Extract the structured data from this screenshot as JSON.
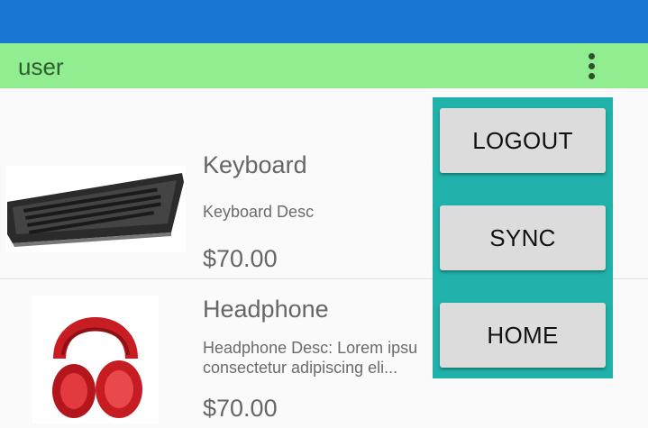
{
  "app_bar": {
    "title": "user",
    "overflow_icon": "more-vertical-icon"
  },
  "colors": {
    "status_bar": "#1976d2",
    "app_bar": "#90ee90",
    "menu_bg": "#20b2aa",
    "menu_button": "#dcdcdc"
  },
  "products": [
    {
      "name": "Keyboard",
      "description": "Keyboard Desc",
      "price": "$70.00",
      "image": "keyboard-image"
    },
    {
      "name": "Headphone",
      "description": "Headphone Desc: Lorem ipsu\nconsectetur adipiscing eli...",
      "price": "$70.00",
      "image": "headphone-image"
    }
  ],
  "menu": {
    "logout_label": "LOGOUT",
    "sync_label": "SYNC",
    "home_label": "HOME"
  }
}
